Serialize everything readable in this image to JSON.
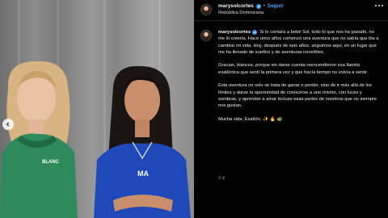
{
  "post": {
    "username": "marysolcortes",
    "follow_label": "Seguir",
    "separator": "•",
    "location": "República Dominicana",
    "caption_paragraphs": [
      "Si le contara a bebé Sol, todo lo que nos ha pasado, no me lo creería. Hace unos años comenzó una aventura que no sabía que iba a cambiar mi vida. Hoy, después de seis años, seguimos aquí, en un lugar que me ha llenado de sueños y de aventuras increíbles.",
      "Gracias, blancos, porque sin darse cuenta reencendieron esa llamita exatlónica que sentí la primera vez y que hacía tiempo no volvía a sentir.",
      "Esta aventura no solo se trata de ganar o perder, sino de ir más allá de los límites y darse la oportunidad de conocerse a uno mismo, con luces y sombras, y aprender a amar incluso esas partes de nosotros que no siempre nos gustan.",
      "Mucha vida, Exatlón. ✨ 🔥 🐢"
    ],
    "timestamp": "2 d"
  },
  "media": {
    "left_shirt_text": "BLANC",
    "right_shirt_text": "MA"
  },
  "colors": {
    "verified_blue": "#3897f0",
    "follow_blue": "#4aa3ff",
    "background": "#000000"
  },
  "icons": {
    "verified": "verified-badge-icon",
    "more": "more-options-icon",
    "carousel_prev": "chevron-left-icon"
  }
}
